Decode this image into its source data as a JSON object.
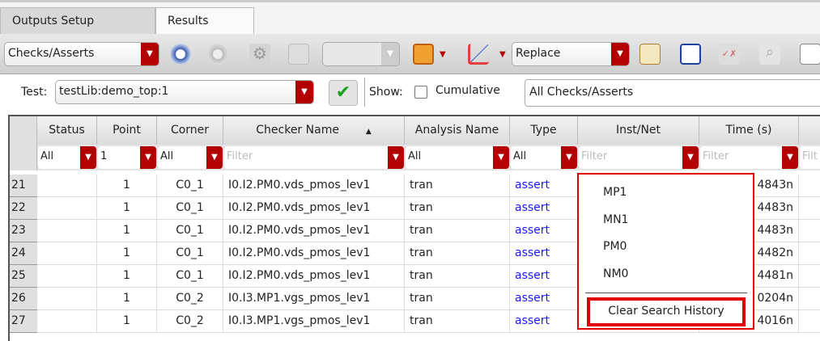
{
  "tabs": [
    {
      "label": "Outputs Setup"
    },
    {
      "label": "Results"
    }
  ],
  "toolbar": {
    "view_select": "Checks/Asserts",
    "plot_mode": "Replace",
    "icons": [
      "back-icon",
      "forward-icon",
      "settings-icon",
      "table-icon",
      "combo-disabled",
      "swap-icon",
      "plot-icon",
      "edit-note-icon",
      "edit-form-icon",
      "check-cross-icon",
      "zoom-icon",
      "report-icon"
    ]
  },
  "testbar": {
    "test_label": "Test:",
    "test_value": "testLib:demo_top:1",
    "show_label": "Show:",
    "cumulative_label": "Cumulative",
    "cumulative_checked": false,
    "filter_value": "All Checks/Asserts"
  },
  "table": {
    "columns": [
      "Status",
      "Point",
      "Corner",
      "Checker Name",
      "Analysis Name",
      "Type",
      "Inst/Net",
      "Time (s)"
    ],
    "filters": [
      "All",
      "1",
      "All",
      "Filter",
      "All",
      "All",
      "Filter",
      "Filter",
      "Filt"
    ],
    "rows": [
      {
        "n": "21",
        "status": "",
        "point": "1",
        "corner": "C0_1",
        "checker": "I0.I2.PM0.vds_pmos_lev1",
        "analysis": "tran",
        "type": "assert",
        "time": "4843n"
      },
      {
        "n": "22",
        "status": "",
        "point": "1",
        "corner": "C0_1",
        "checker": "I0.I2.PM0.vds_pmos_lev1",
        "analysis": "tran",
        "type": "assert",
        "time": "4483n"
      },
      {
        "n": "23",
        "status": "",
        "point": "1",
        "corner": "C0_1",
        "checker": "I0.I2.PM0.vds_pmos_lev1",
        "analysis": "tran",
        "type": "assert",
        "time": "4483n"
      },
      {
        "n": "24",
        "status": "",
        "point": "1",
        "corner": "C0_1",
        "checker": "I0.I2.PM0.vds_pmos_lev1",
        "analysis": "tran",
        "type": "assert",
        "time": "4482n"
      },
      {
        "n": "25",
        "status": "",
        "point": "1",
        "corner": "C0_1",
        "checker": "I0.I2.PM0.vds_pmos_lev1",
        "analysis": "tran",
        "type": "assert",
        "time": "4481n"
      },
      {
        "n": "26",
        "status": "",
        "point": "1",
        "corner": "C0_2",
        "checker": "I0.I3.MP1.vgs_pmos_lev1",
        "analysis": "tran",
        "type": "assert",
        "time": "0204n"
      },
      {
        "n": "27",
        "status": "",
        "point": "1",
        "corner": "C0_2",
        "checker": "I0.I3.MP1.vgs_pmos_lev1",
        "analysis": "tran",
        "type": "assert",
        "time": "4016n"
      }
    ]
  },
  "popup": {
    "items": [
      "MP1",
      "MN1",
      "PM0",
      "NM0"
    ],
    "clear": "Clear Search History"
  },
  "colors": {
    "accent": "#b30000",
    "link": "#1a1aff",
    "highlight": "#e00000"
  }
}
